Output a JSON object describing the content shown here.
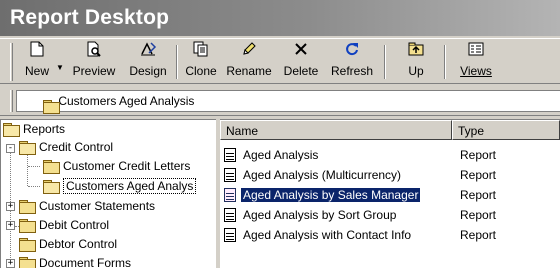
{
  "window": {
    "title": "Report Desktop"
  },
  "toolbar": {
    "buttons": [
      {
        "label": "New",
        "icon": "new-document-icon"
      },
      {
        "label": "Preview",
        "icon": "preview-icon"
      },
      {
        "label": "Design",
        "icon": "design-icon"
      },
      {
        "label": "Clone",
        "icon": "clone-icon"
      },
      {
        "label": "Rename",
        "icon": "rename-pencil-icon"
      },
      {
        "label": "Delete",
        "icon": "delete-x-icon"
      },
      {
        "label": "Refresh",
        "icon": "refresh-icon"
      },
      {
        "label": "Up",
        "icon": "up-folder-icon"
      },
      {
        "label": "Views",
        "icon": "views-icon"
      }
    ]
  },
  "address": {
    "path": "Customers Aged Analysis"
  },
  "tree": {
    "items": [
      {
        "label": "Reports",
        "level": 0,
        "expander": "-"
      },
      {
        "label": "Credit Control",
        "level": 1,
        "expander": "-"
      },
      {
        "label": "Customer Credit Letters",
        "level": 2,
        "expander": ""
      },
      {
        "label": "Customers Aged Analys",
        "level": 2,
        "expander": "",
        "selected": true
      },
      {
        "label": "Customer Statements",
        "level": 1,
        "expander": "+"
      },
      {
        "label": "Debit Control",
        "level": 1,
        "expander": "+"
      },
      {
        "label": "Debtor Control",
        "level": 1,
        "expander": ""
      },
      {
        "label": "Document Forms",
        "level": 1,
        "expander": "+"
      }
    ]
  },
  "list": {
    "columns": [
      "Name",
      "Type"
    ],
    "rows": [
      {
        "name": "Aged Analysis",
        "type": "Report",
        "selected": false
      },
      {
        "name": "Aged Analysis (Multicurrency)",
        "type": "Report",
        "selected": false
      },
      {
        "name": "Aged Analysis by Sales Manager",
        "type": "Report",
        "selected": true
      },
      {
        "name": "Aged Analysis by Sort Group",
        "type": "Report",
        "selected": false
      },
      {
        "name": "Aged Analysis with Contact Info",
        "type": "Report",
        "selected": false
      }
    ]
  },
  "colors": {
    "selection": "#0a246a",
    "window_face": "#d4d0c8",
    "title_gradient_start": "#6e6e6e"
  }
}
